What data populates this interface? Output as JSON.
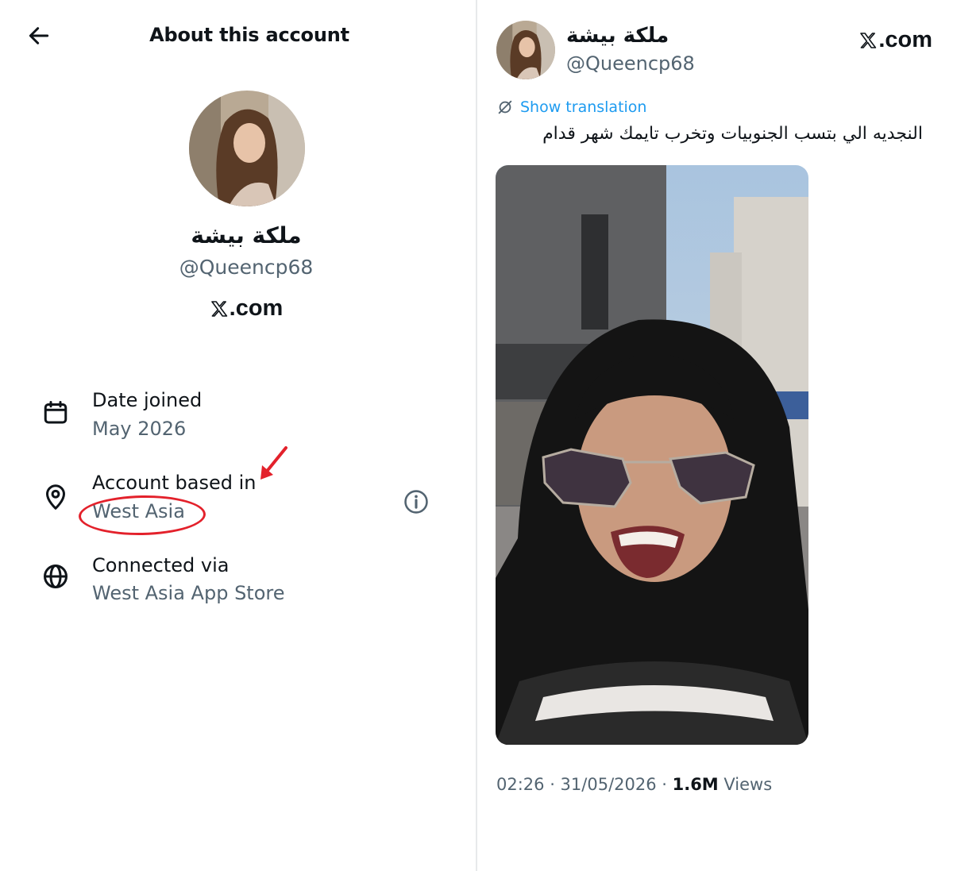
{
  "about_panel": {
    "title": "About this account",
    "display_name": "ملكة بيشة",
    "handle": "@Queencp68",
    "site_label": ".com",
    "rows": [
      {
        "icon": "calendar-icon",
        "label": "Date joined",
        "value": "May 2026"
      },
      {
        "icon": "location-pin-icon",
        "label": "Account based in",
        "value": "West Asia"
      },
      {
        "icon": "globe-icon",
        "label": "Connected via",
        "value": "West Asia App Store"
      }
    ]
  },
  "tweet_panel": {
    "display_name": "ملكة بيشة",
    "handle": "@Queencp68",
    "site_label": ".com",
    "translate_label": "Show translation",
    "text": "النجديه الي بتسب الجنوبيات وتخرب تايمك شهر قدام",
    "timestamp": "02:26 · 31/05/2026 · ",
    "views_count": "1.6M",
    "views_label": " Views"
  },
  "colors": {
    "accent_blue": "#1d9bf0",
    "secondary_text": "#536471",
    "annotation_red": "#e3212b"
  }
}
